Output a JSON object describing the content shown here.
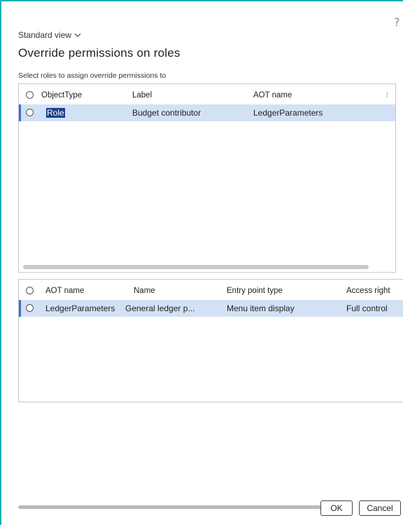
{
  "dialog": {
    "help_label": "?",
    "view_label": "Standard view",
    "title": "Override permissions on roles",
    "caption": "Select roles to assign override permissions to"
  },
  "roles_grid": {
    "columns": [
      "ObjectType",
      "Label",
      "AOT name"
    ],
    "more_label": "⁝",
    "rows": [
      {
        "object_type": "Role",
        "label": "Budget contributor",
        "aot_name": "LedgerParameters"
      }
    ]
  },
  "entry_grid": {
    "columns": [
      "AOT name",
      "Name",
      "Entry point type",
      "Access right"
    ],
    "rows": [
      {
        "aot_name": "LedgerParameters",
        "name": "General ledger p...",
        "entry_point_type": "Menu item display",
        "access_right": "Full control"
      }
    ]
  },
  "buttons": {
    "ok": "OK",
    "cancel": "Cancel"
  },
  "colors": {
    "accent_border": "#18b0b3",
    "selected_row": "#d3e1f5",
    "selection_bar": "#3b6fcf"
  }
}
